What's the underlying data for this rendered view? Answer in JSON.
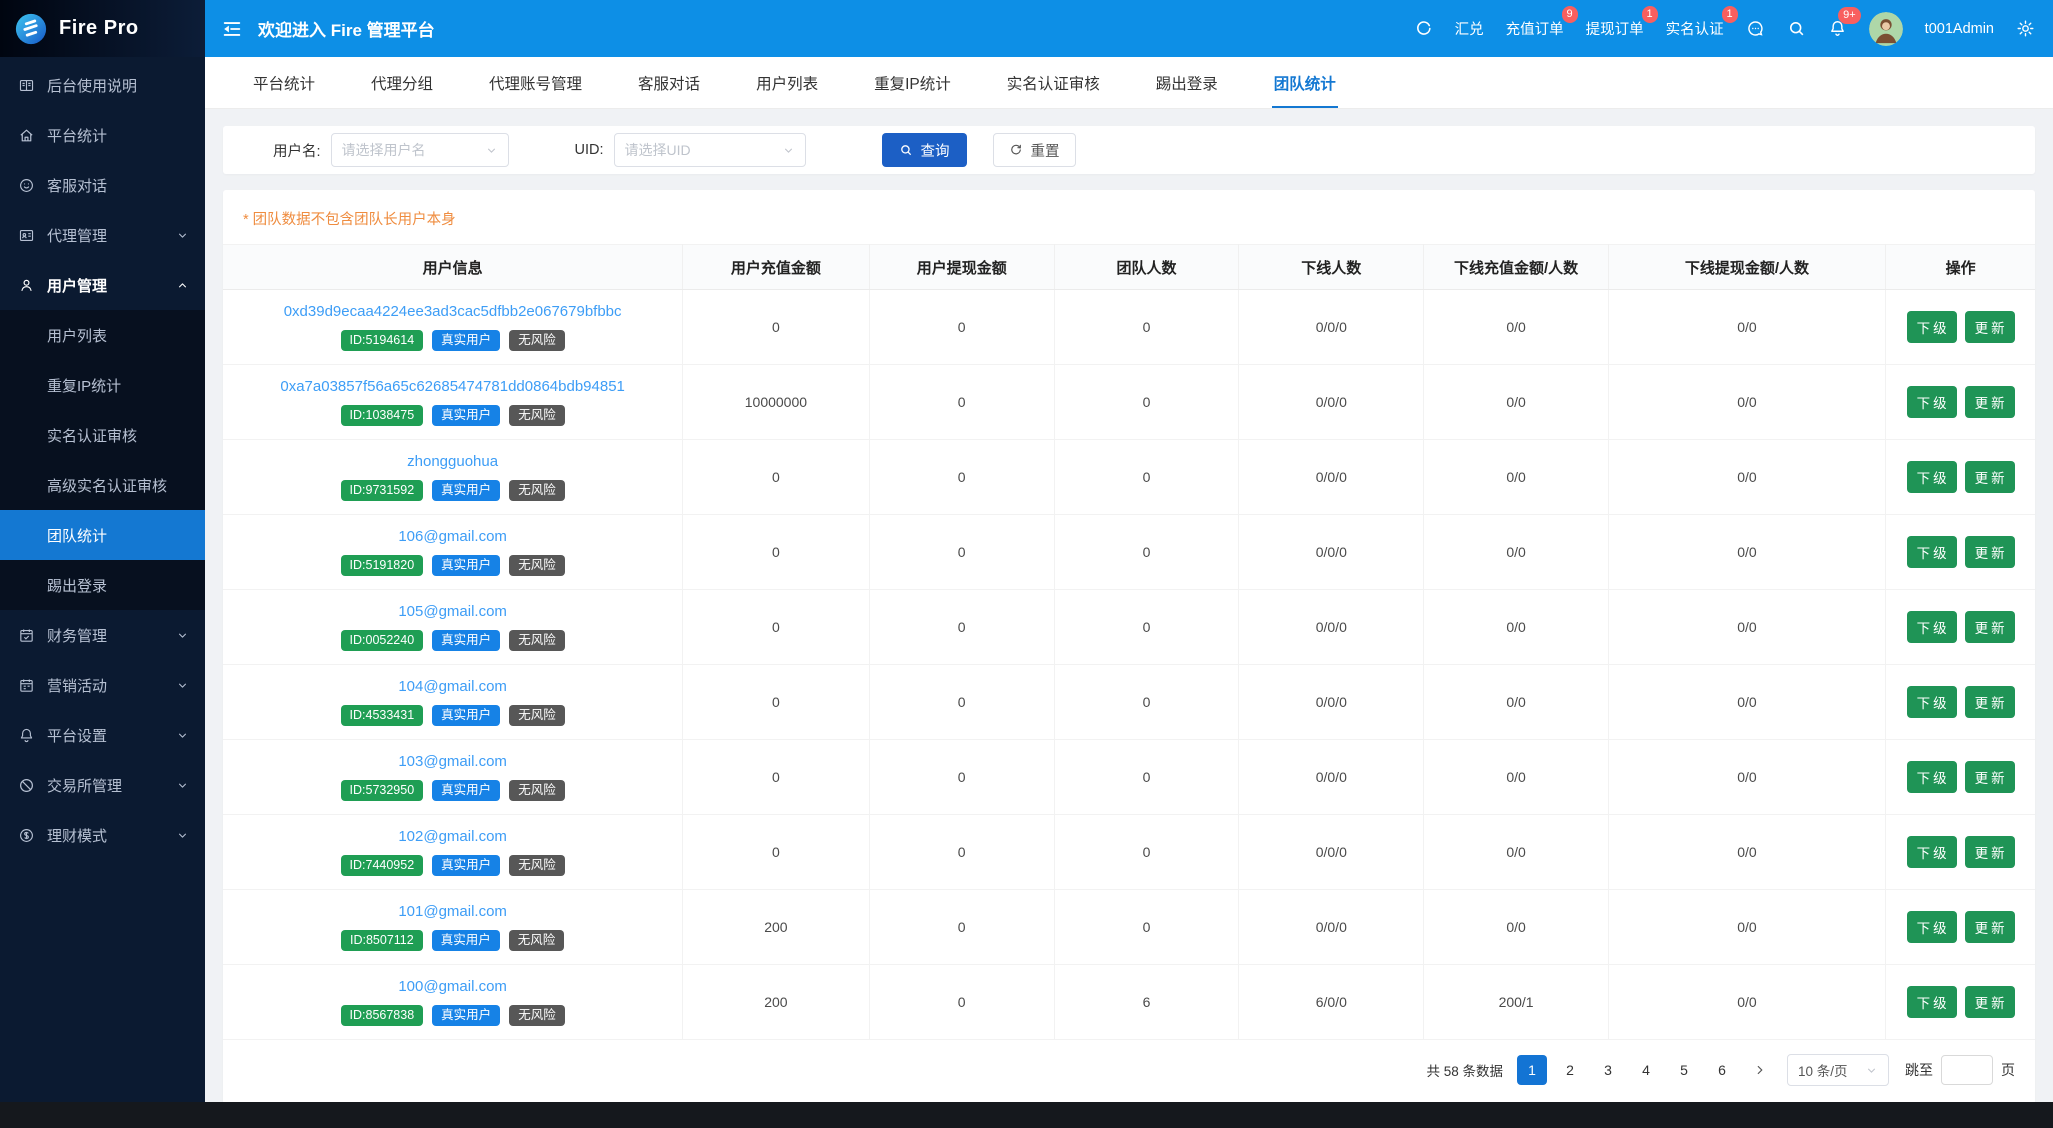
{
  "app": {
    "logo_text": "Fire Pro"
  },
  "header": {
    "title": "欢迎进入 Fire 管理平台",
    "nav": [
      {
        "label": "汇兑",
        "badge": ""
      },
      {
        "label": "充值订单",
        "badge": "9"
      },
      {
        "label": "提现订单",
        "badge": "1"
      },
      {
        "label": "实名认证",
        "badge": "1"
      }
    ],
    "bell_badge": "9+",
    "username": "t001Admin"
  },
  "sidebar": {
    "items": [
      {
        "label": "后台使用说明",
        "icon": "manual",
        "group": false
      },
      {
        "label": "平台统计",
        "icon": "home",
        "group": false
      },
      {
        "label": "客服对话",
        "icon": "chat",
        "group": false
      },
      {
        "label": "代理管理",
        "icon": "agent",
        "group": true,
        "expanded": false
      },
      {
        "label": "用户管理",
        "icon": "user",
        "group": true,
        "expanded": true,
        "children": [
          {
            "label": "用户列表",
            "active": false
          },
          {
            "label": "重复IP统计",
            "active": false
          },
          {
            "label": "实名认证审核",
            "active": false
          },
          {
            "label": "高级实名认证审核",
            "active": false
          },
          {
            "label": "团队统计",
            "active": true
          },
          {
            "label": "踢出登录",
            "active": false
          }
        ]
      },
      {
        "label": "财务管理",
        "icon": "finance",
        "group": true,
        "expanded": false
      },
      {
        "label": "营销活动",
        "icon": "calendar",
        "group": true,
        "expanded": false
      },
      {
        "label": "平台设置",
        "icon": "bell",
        "group": true,
        "expanded": false
      },
      {
        "label": "交易所管理",
        "icon": "exchange",
        "group": true,
        "expanded": false
      },
      {
        "label": "理财模式",
        "icon": "wealth",
        "group": true,
        "expanded": false
      }
    ]
  },
  "tabs": {
    "items": [
      "平台统计",
      "代理分组",
      "代理账号管理",
      "客服对话",
      "用户列表",
      "重复IP统计",
      "实名认证审核",
      "踢出登录",
      "团队统计"
    ],
    "active_index": 8
  },
  "filter": {
    "username_label": "用户名:",
    "username_placeholder": "请选择用户名",
    "uid_label": "UID:",
    "uid_placeholder": "请选择UID",
    "query_label": "查询",
    "reset_label": "重置"
  },
  "notice": "* 团队数据不包含团队长用户本身",
  "table": {
    "columns": [
      "用户信息",
      "用户充值金额",
      "用户提现金额",
      "团队人数",
      "下线人数",
      "下线充值金额/人数",
      "下线提现金额/人数",
      "操作"
    ],
    "rows": [
      {
        "name": "0xd39d9ecaa4224ee3ad3cac5dfbb2e067679bfbbc",
        "id": "ID:5194614",
        "tags": [
          "真实用户",
          "无风险"
        ],
        "values": [
          "0",
          "0",
          "0",
          "0/0/0",
          "0/0",
          "0/0"
        ],
        "actions": [
          "下级",
          "更新"
        ]
      },
      {
        "name": "0xa7a03857f56a65c62685474781dd0864bdb94851",
        "id": "ID:1038475",
        "tags": [
          "真实用户",
          "无风险"
        ],
        "values": [
          "10000000",
          "0",
          "0",
          "0/0/0",
          "0/0",
          "0/0"
        ],
        "actions": [
          "下级",
          "更新"
        ]
      },
      {
        "name": "zhongguohua",
        "id": "ID:9731592",
        "tags": [
          "真实用户",
          "无风险"
        ],
        "values": [
          "0",
          "0",
          "0",
          "0/0/0",
          "0/0",
          "0/0"
        ],
        "actions": [
          "下级",
          "更新"
        ]
      },
      {
        "name": "106@gmail.com",
        "id": "ID:5191820",
        "tags": [
          "真实用户",
          "无风险"
        ],
        "values": [
          "0",
          "0",
          "0",
          "0/0/0",
          "0/0",
          "0/0"
        ],
        "actions": [
          "下级",
          "更新"
        ]
      },
      {
        "name": "105@gmail.com",
        "id": "ID:0052240",
        "tags": [
          "真实用户",
          "无风险"
        ],
        "values": [
          "0",
          "0",
          "0",
          "0/0/0",
          "0/0",
          "0/0"
        ],
        "actions": [
          "下级",
          "更新"
        ]
      },
      {
        "name": "104@gmail.com",
        "id": "ID:4533431",
        "tags": [
          "真实用户",
          "无风险"
        ],
        "values": [
          "0",
          "0",
          "0",
          "0/0/0",
          "0/0",
          "0/0"
        ],
        "actions": [
          "下级",
          "更新"
        ]
      },
      {
        "name": "103@gmail.com",
        "id": "ID:5732950",
        "tags": [
          "真实用户",
          "无风险"
        ],
        "values": [
          "0",
          "0",
          "0",
          "0/0/0",
          "0/0",
          "0/0"
        ],
        "actions": [
          "下级",
          "更新"
        ]
      },
      {
        "name": "102@gmail.com",
        "id": "ID:7440952",
        "tags": [
          "真实用户",
          "无风险"
        ],
        "values": [
          "0",
          "0",
          "0",
          "0/0/0",
          "0/0",
          "0/0"
        ],
        "actions": [
          "下级",
          "更新"
        ]
      },
      {
        "name": "101@gmail.com",
        "id": "ID:8507112",
        "tags": [
          "真实用户",
          "无风险"
        ],
        "values": [
          "200",
          "0",
          "0",
          "0/0/0",
          "0/0",
          "0/0"
        ],
        "actions": [
          "下级",
          "更新"
        ]
      },
      {
        "name": "100@gmail.com",
        "id": "ID:8567838",
        "tags": [
          "真实用户",
          "无风险"
        ],
        "values": [
          "200",
          "0",
          "6",
          "6/0/0",
          "200/1",
          "0/0"
        ],
        "actions": [
          "下级",
          "更新"
        ]
      }
    ]
  },
  "pagination": {
    "total_text": "共 58 条数据",
    "pages": [
      "1",
      "2",
      "3",
      "4",
      "5",
      "6"
    ],
    "active_page": "1",
    "page_size": "10 条/页",
    "jump_label": "跳至",
    "jump_unit": "页",
    "jump_value": ""
  },
  "colors": {
    "header_blue": "#0d8fe6",
    "primary_blue": "#1478d2",
    "query_button_blue": "#1c5fc5",
    "pagination_active_blue": "#1374d4",
    "badge_green": "#1f9e54",
    "badge_blue": "#1682e6",
    "badge_gray": "#575757",
    "action_green": "#1f9456",
    "link_blue": "#3d9df6",
    "notice_orange": "#ef8c3f",
    "count_badge_red": "#f85f5f",
    "sidebar_navy": "#0b1a31"
  }
}
